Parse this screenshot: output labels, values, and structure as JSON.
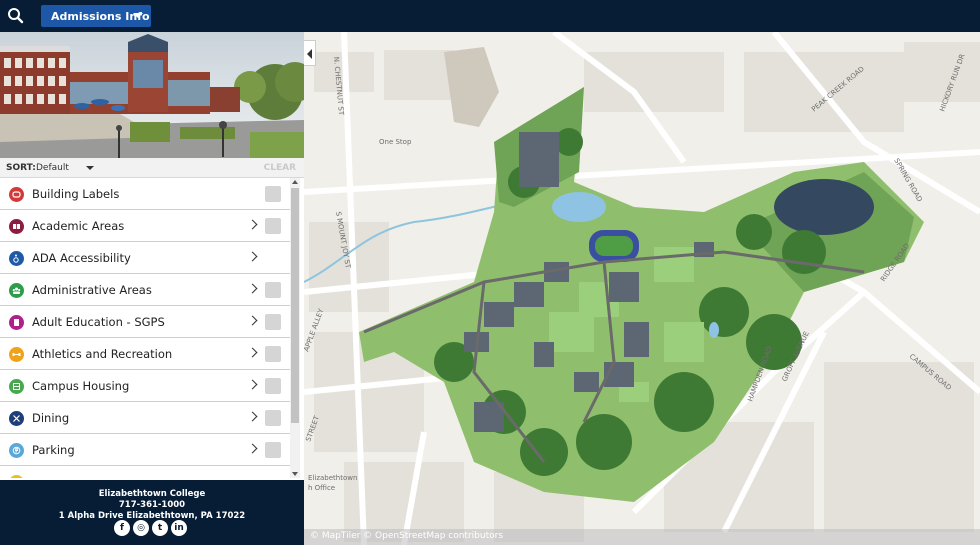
{
  "topbar": {
    "admissions_label": "Admissions Info"
  },
  "sidebar": {
    "sort_label": "SORT:",
    "sort_value": "Default",
    "clear_label": "CLEAR",
    "items": [
      {
        "label": "Building Labels",
        "icon": "building-labels-icon",
        "color": "#d23a3a",
        "has_chevron": false
      },
      {
        "label": "Academic Areas",
        "icon": "book-icon",
        "color": "#8b1e3f",
        "has_chevron": true
      },
      {
        "label": "ADA Accessibility",
        "icon": "wheelchair-icon",
        "color": "#1f5aa6",
        "has_chevron": true
      },
      {
        "label": "Administrative Areas",
        "icon": "people-icon",
        "color": "#2e9c4b",
        "has_chevron": true
      },
      {
        "label": "Adult Education - SGPS",
        "icon": "building-icon",
        "color": "#b0208a",
        "has_chevron": true
      },
      {
        "label": "Athletics and Recreation",
        "icon": "dumbbell-icon",
        "color": "#f0a21a",
        "has_chevron": true
      },
      {
        "label": "Campus Housing",
        "icon": "housing-icon",
        "color": "#48a84f",
        "has_chevron": true
      },
      {
        "label": "Dining",
        "icon": "utensils-icon",
        "color": "#1d3e7a",
        "has_chevron": true
      },
      {
        "label": "Parking",
        "icon": "parking-icon",
        "color": "#5aa8d8",
        "has_chevron": true
      }
    ]
  },
  "footer": {
    "name": "Elizabethtown College",
    "phone": "717-361-1000",
    "address": "1 Alpha Drive Elizabethtown, PA 17022",
    "socials": [
      {
        "name": "facebook-icon",
        "glyph": "f"
      },
      {
        "name": "instagram-icon",
        "glyph": "◎"
      },
      {
        "name": "twitter-icon",
        "glyph": "t"
      },
      {
        "name": "linkedin-icon",
        "glyph": "in"
      }
    ]
  },
  "map": {
    "attribution": "© MapTiler © OpenStreetMap contributors",
    "labels": {
      "chestnut": "N. CHESTNUT ST",
      "one_stop": "One Stop",
      "mount_joy": "S MOUNT JOY ST",
      "apple_alley": "APPLE ALLEY",
      "street": "STREET",
      "peak_creek": "PEAK CREEK ROAD",
      "spring": "SPRING ROAD",
      "hickory": "HICKORY RUN DR",
      "ridge": "RIDGE ROAD",
      "hampden": "HAMPDEN ROAD",
      "groff": "GROFF AVENUE",
      "campus_road": "CAMPUS ROAD",
      "elizabethtown": "Elizabethtown",
      "office": "h Office"
    }
  },
  "colors": {
    "navy": "#071d36",
    "button_blue": "#1d58a8",
    "campus_green": "#5f9a46"
  }
}
